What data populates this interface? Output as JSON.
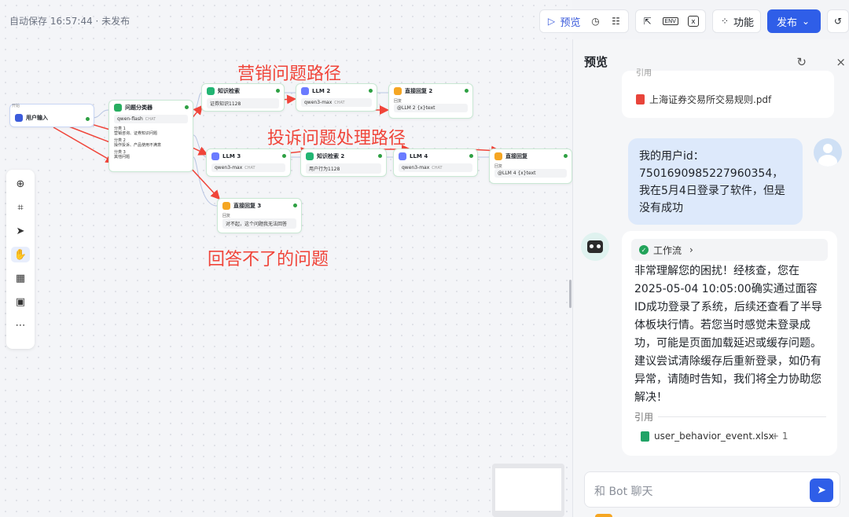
{
  "autosave": "自动保存 16:57:44 · 未发布",
  "toolbar": {
    "preview_label": "预览",
    "features_label": "功能",
    "publish_label": "发布",
    "env_label": "ENV"
  },
  "nodes": {
    "start": {
      "group": "开始",
      "title": "用户输入"
    },
    "classifier": {
      "title": "问题分类器",
      "model": "qwen-flash",
      "model_tag": "CHAT",
      "cases": [
        {
          "label": "分类 1",
          "text": "营销咨询、证券知识问题"
        },
        {
          "label": "分类 2",
          "text": "操作投诉、产品使用不满意"
        },
        {
          "label": "分类 3",
          "text": "其他问题"
        }
      ]
    },
    "kb1": {
      "title": "知识检索",
      "sub": "证券知识1128"
    },
    "llm2": {
      "title": "LLM 2",
      "model": "qwen3-max",
      "tag": "CHAT"
    },
    "reply2": {
      "title": "直接回复 2",
      "lbl": "回复",
      "sub": "@LLM 2 {x}text"
    },
    "llm3": {
      "title": "LLM 3",
      "model": "qwen3-max",
      "tag": "CHAT"
    },
    "kb2": {
      "title": "知识检索 2",
      "sub": "用户行为1128"
    },
    "llm4": {
      "title": "LLM 4",
      "model": "qwen3-max",
      "tag": "CHAT"
    },
    "reply1": {
      "title": "直接回复",
      "lbl": "回复",
      "sub": "@LLM 4 {x}text"
    },
    "reply3": {
      "title": "直接回复 3",
      "lbl": "回复",
      "sub": "对不起，这个问题我无法回答"
    }
  },
  "annotations": {
    "marketing": "营销问题路径",
    "complaint": "投诉问题处理路径",
    "unanswerable": "回答不了的问题"
  },
  "panel": {
    "title": "预览",
    "prev_ref_file": "上海证券交易所交易规则.pdf",
    "prev_ref_label": "引用",
    "user_message": "我的用户id：7501690985227960354，我在5月4日登录了软件，但是没有成功",
    "workflow_label": "工作流",
    "bot_message": "非常理解您的困扰！经核查，您在2025-05-04 10:05:00确实通过面容ID成功登录了系统，后续还查看了半导体板块行情。若您当时感觉未登录成功，可能是页面加载延迟或缓存问题。建议尝试清除缓存后重新登录，如仍有异常，请随时告知，我们将全力协助您解决！",
    "cite_label": "引用",
    "cite_file": "user_behavior_event.xlsx",
    "cite_more": "+ 1",
    "input_placeholder": "和 Bot 聊天"
  },
  "colors": {
    "accent": "#2f5ee8",
    "annotation": "#f0453a",
    "node_border": "#c9e8d4"
  }
}
